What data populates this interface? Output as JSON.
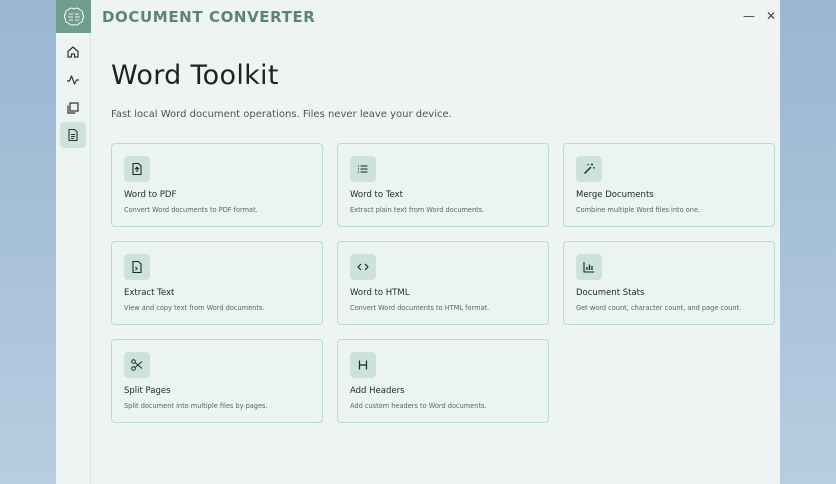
{
  "app": {
    "title": "DOCUMENT CONVERTER",
    "minimize_label": "—",
    "close_label": "✕"
  },
  "sidebar": {
    "items": [
      {
        "icon": "home-icon",
        "active": false
      },
      {
        "icon": "activity-icon",
        "active": false
      },
      {
        "icon": "library-icon",
        "active": false
      },
      {
        "icon": "document-icon",
        "active": true
      }
    ]
  },
  "page": {
    "title": "Word Toolkit",
    "subtitle": "Fast local Word document operations. Files never leave your device."
  },
  "cards": [
    {
      "title": "Word to PDF",
      "desc": "Convert Word documents to PDF format.",
      "icon": "file-export-icon"
    },
    {
      "title": "Word to Text",
      "desc": "Extract plain text from Word documents.",
      "icon": "list-icon"
    },
    {
      "title": "Merge Documents",
      "desc": "Combine multiple Word files into one.",
      "icon": "magic-wand-icon"
    },
    {
      "title": "Extract Text",
      "desc": "View and copy text from Word documents.",
      "icon": "file-text-icon"
    },
    {
      "title": "Word to HTML",
      "desc": "Convert Word documents to HTML format.",
      "icon": "code-icon"
    },
    {
      "title": "Document Stats",
      "desc": "Get word count, character count, and page count.",
      "icon": "bar-chart-icon"
    },
    {
      "title": "Split Pages",
      "desc": "Split document into multiple files by pages.",
      "icon": "scissors-icon"
    },
    {
      "title": "Add Headers",
      "desc": "Add custom headers to Word documents.",
      "icon": "heading-icon"
    }
  ],
  "colors": {
    "accent": "#6f9e8c",
    "card_border": "#b9dbd0",
    "icon_bg": "#cde2dc"
  }
}
